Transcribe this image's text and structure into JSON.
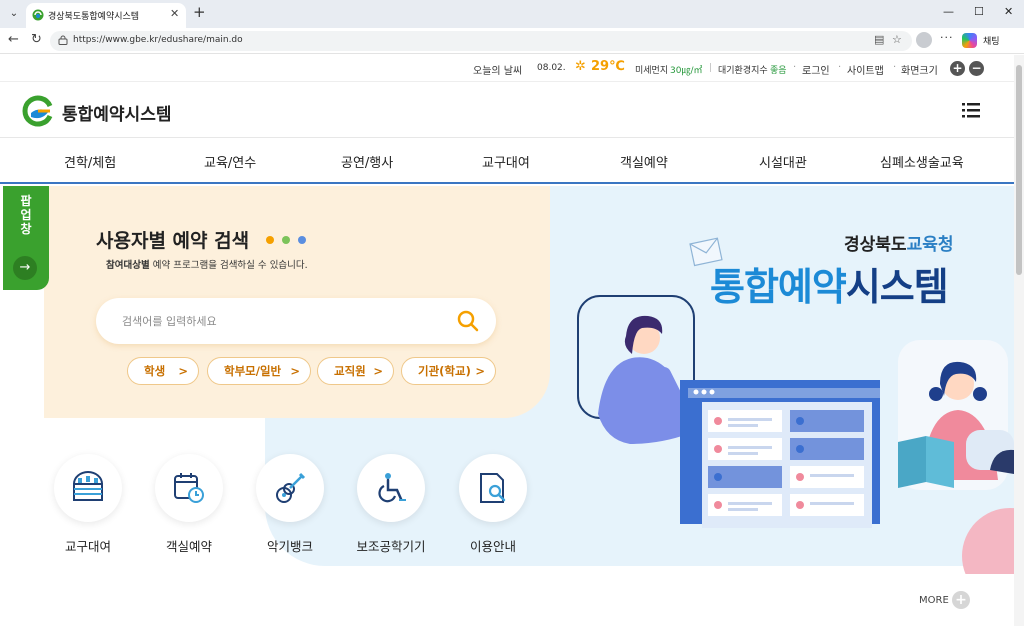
{
  "browser": {
    "tab_title": "경상북도통합예약시스템",
    "url": "https://www.gbe.kr/edushare/main.do",
    "chat_label": "채팅"
  },
  "util_bar": {
    "weather_label": "오늘의 날씨",
    "date": "08.02.",
    "temperature": "29℃",
    "fine_dust_label": "미세먼지",
    "fine_dust_value": "30㎍/㎥",
    "divider": "|",
    "air_index_label": "대기환경지수",
    "air_index_value": "좋음",
    "bullet": "·",
    "login": "로그인",
    "sitemap": "사이트맵",
    "screen_size": "화면크기",
    "zoom_in": "+",
    "zoom_out": "−"
  },
  "header": {
    "logo_text": "통합예약시스템"
  },
  "gnb": {
    "items": [
      "견학/체험",
      "교육/연수",
      "공연/행사",
      "교구대여",
      "객실예약",
      "시설대관",
      "심폐소생술교육"
    ]
  },
  "popup": {
    "label": "팝업창",
    "arrow": "→"
  },
  "search_section": {
    "title": "사용자별 예약 검색",
    "subtitle_bold": "참여대상별",
    "subtitle_rest": "예약 프로그램을 검색하실 수 있습니다.",
    "placeholder": "검색어를 입력하세요",
    "chips": [
      "학생",
      "학부모/일반",
      "교직원",
      "기관(학교)"
    ],
    "chevron": ">"
  },
  "quick_menu": [
    {
      "label": "교구대여",
      "icon": "abacus-icon"
    },
    {
      "label": "객실예약",
      "icon": "calendar-clock-icon"
    },
    {
      "label": "악기뱅크",
      "icon": "guitar-icon"
    },
    {
      "label": "보조공학기기",
      "icon": "wheelchair-icon"
    },
    {
      "label": "이용안내",
      "icon": "document-search-icon"
    }
  ],
  "banner": {
    "sub_prefix": "경상북도",
    "sub_suffix": "교육청",
    "main_prefix": "통합예약",
    "main_suffix": "시스템"
  },
  "more": {
    "label": "MORE",
    "plus": "+"
  },
  "colors": {
    "accent_blue": "#1c8ad6",
    "navy": "#143f86",
    "orange": "#f5a000",
    "popup_green": "#3aa12e",
    "card_cream": "#fdf0dc"
  }
}
